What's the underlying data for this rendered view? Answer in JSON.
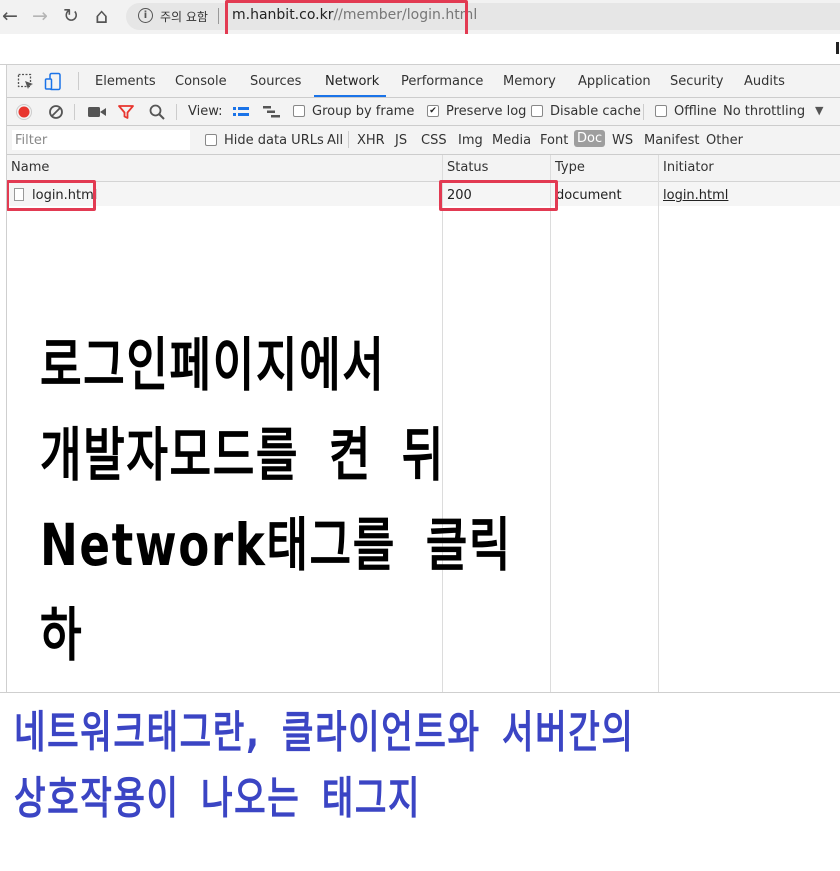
{
  "browser": {
    "back_glyph": "←",
    "forward_glyph": "→",
    "reload_glyph": "↻",
    "home_glyph": "⌂",
    "security_label": "주의 요함",
    "url_host": "m.hanbit.co.kr",
    "url_path": "//member/login.html"
  },
  "devtools": {
    "tabs": [
      "Elements",
      "Console",
      "Sources",
      "Network",
      "Performance",
      "Memory",
      "Application",
      "Security",
      "Audits"
    ],
    "active_tab": "Network",
    "toolbar": {
      "view_label": "View:",
      "group_by_frame": "Group by frame",
      "preserve_log": "Preserve log",
      "disable_cache": "Disable cache",
      "offline": "Offline",
      "throttling": "No throttling"
    },
    "filter": {
      "placeholder": "Filter",
      "hide_data_urls": "Hide data URLs",
      "types": [
        "All",
        "XHR",
        "JS",
        "CSS",
        "Img",
        "Media",
        "Font",
        "Doc",
        "WS",
        "Manifest",
        "Other"
      ],
      "selected_type": "Doc"
    },
    "columns": [
      "Name",
      "Status",
      "Type",
      "Initiator"
    ],
    "rows": [
      {
        "name": "login.html",
        "status": "200",
        "type": "document",
        "initiator": "login.html"
      }
    ]
  },
  "captions": {
    "main": "로그인페이지에서\n개발자모드를 켠 뒤\nNetwork태그를 클릭하\n면 다음이 나타난다.",
    "note": "네트워크태그란, 클라이언트와 서버간의\n상호작용이 나오는 태그지"
  },
  "colors": {
    "highlight": "#e23a52",
    "active_tab": "#1a73e8",
    "record": "#e8352e",
    "filter_icon": "#e8352e",
    "note_text": "#3b45c4"
  }
}
